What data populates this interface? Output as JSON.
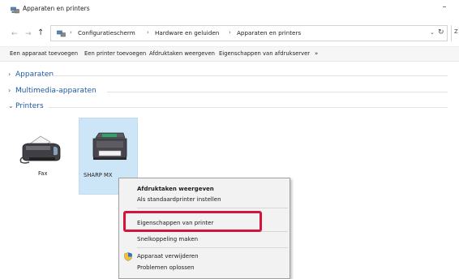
{
  "window": {
    "title": "Apparaten en printers",
    "minimize_glyph": "–"
  },
  "address": {
    "crumbs": [
      "Configuratiescherm",
      "Hardware en geluiden",
      "Apparaten en printers"
    ],
    "separator": "›",
    "dropdown_glyph": "⌄",
    "refresh_glyph": "↻",
    "extra_glyph": "Z"
  },
  "nav": {
    "back": "←",
    "forward": "→",
    "up": "↑"
  },
  "toolbar": {
    "items": [
      "Een apparaat toevoegen",
      "Een printer toevoegen",
      "Afdruktaken weergeven",
      "Eigenschappen van afdrukserver",
      "»"
    ]
  },
  "groups": [
    {
      "chevron": "›",
      "label": "Apparaten"
    },
    {
      "chevron": "›",
      "label": "Multimedia-apparaten"
    },
    {
      "chevron": "⌄",
      "label": "Printers"
    }
  ],
  "devices": [
    {
      "label": "Fax",
      "icon": "fax-icon",
      "selected": false
    },
    {
      "label": "SHARP MX",
      "icon": "printer-icon",
      "selected": true
    }
  ],
  "context_menu": {
    "items": [
      {
        "label": "Afdruktaken weergeven",
        "bold": true
      },
      {
        "label": "Als standaardprinter instellen",
        "bold": false
      },
      {
        "label": "Eigenschappen van printer",
        "bold": false,
        "highlighted": true
      },
      {
        "label": "Snelkoppeling maken",
        "bold": false
      },
      {
        "label": "Apparaat verwijderen",
        "bold": false,
        "icon": "shield-icon"
      },
      {
        "label": "Problemen oplossen",
        "bold": false
      }
    ]
  },
  "colors": {
    "highlight": "#d4143a",
    "selection": "#cde6f7",
    "group_link": "#1e5aa8"
  }
}
